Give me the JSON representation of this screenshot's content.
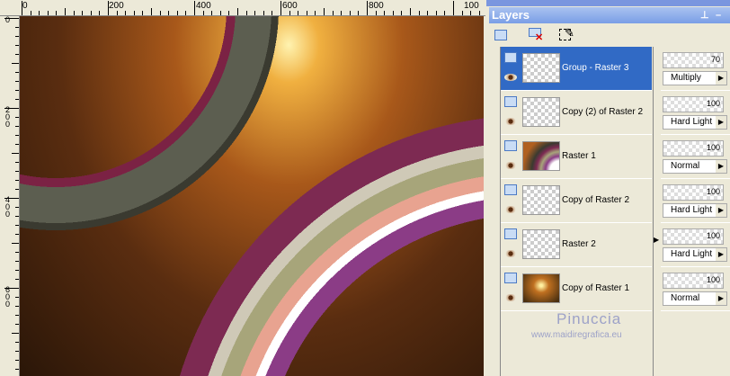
{
  "ruler": {
    "h_labels": [
      "0",
      "200",
      "400",
      "600",
      "800",
      "100"
    ],
    "v_labels": [
      "0",
      "200",
      "400",
      "600"
    ]
  },
  "panel": {
    "title": "Layers",
    "pin_icon": "pin-icon",
    "min_icon": "minimize-icon"
  },
  "toolbar": [
    {
      "icon": "new-layer-icon"
    },
    {
      "icon": "delete-layer-icon"
    },
    {
      "icon": "edit-selection-icon"
    }
  ],
  "layers": [
    {
      "name": "Group - Raster 3",
      "opacity": "70",
      "blend": "Multiply",
      "selected": true
    },
    {
      "name": "Copy (2) of Raster 2",
      "opacity": "100",
      "blend": "Hard Light"
    },
    {
      "name": "Raster 1",
      "opacity": "100",
      "blend": "Normal"
    },
    {
      "name": "Copy of Raster 2",
      "opacity": "100",
      "blend": "Hard Light"
    },
    {
      "name": "Raster 2",
      "opacity": "100",
      "blend": "Hard Light"
    },
    {
      "name": "Copy of Raster 1",
      "opacity": "100",
      "blend": "Normal"
    }
  ],
  "watermark": {
    "name": "Pinuccia",
    "url": "www.maidiregrafica.eu"
  }
}
